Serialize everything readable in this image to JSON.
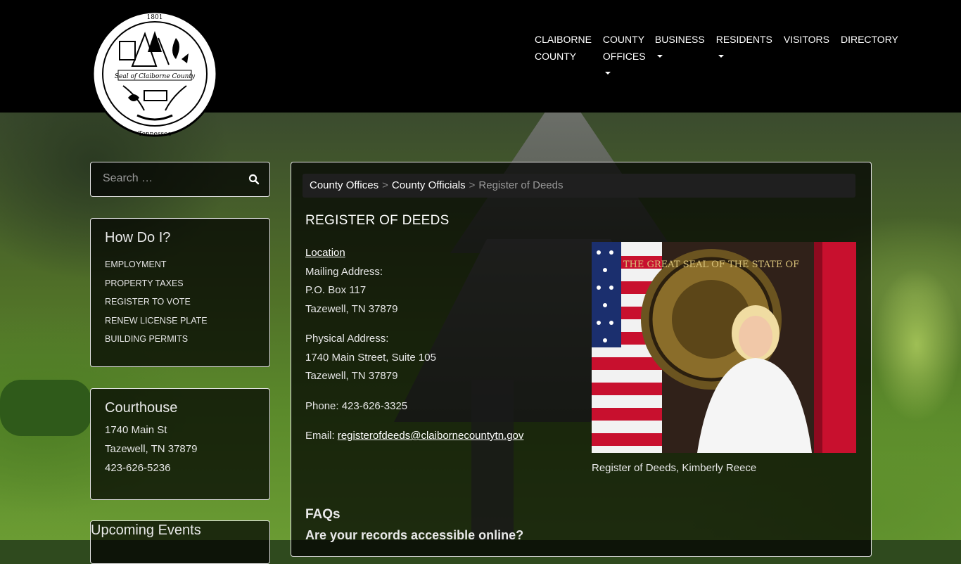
{
  "header": {
    "seal_text_top": "1801",
    "seal_text_middle": "Seal of Claiborne County",
    "seal_text_bottom": "Tennessee",
    "nav": [
      {
        "label_line1": "CLAIBORNE",
        "label_line2": "COUNTY"
      },
      {
        "label_line1": "COUNTY",
        "label_line2": "OFFICES"
      },
      {
        "label_line1": "BUSINESS",
        "label_line2": ""
      },
      {
        "label_line1": "RESIDENTS",
        "label_line2": ""
      },
      {
        "label_line1": "VISITORS",
        "label_line2": ""
      },
      {
        "label_line1": "DIRECTORY",
        "label_line2": ""
      }
    ]
  },
  "sidebar": {
    "search_placeholder": "Search …",
    "howdoi": {
      "title": "How Do I?",
      "items": [
        "EMPLOYMENT",
        "PROPERTY TAXES",
        "REGISTER TO VOTE",
        "RENEW LICENSE PLATE",
        "BUILDING PERMITS"
      ]
    },
    "courthouse": {
      "title": "Courthouse",
      "street": "1740 Main St",
      "city": "Tazewell, TN 37879",
      "phone": "423-626-5236"
    },
    "events_title": "Upcoming Events"
  },
  "breadcrumb": {
    "item1": "County Offices",
    "item2": "County Officials",
    "current": "Register of Deeds",
    "sep": ">"
  },
  "main": {
    "title": "REGISTER OF DEEDS",
    "location_label": "Location",
    "mailing_label": "Mailing Address:",
    "mailing_line1": "P.O. Box 117",
    "mailing_line2": "Tazewell, TN 37879",
    "physical_label": "Physical Address:",
    "physical_line1": "1740 Main Street, Suite 105",
    "physical_line2": "Tazewell, TN 37879",
    "phone": "Phone: 423-626-3325",
    "email_label": "Email: ",
    "email": "registerofdeeds@claibornecountytn.gov",
    "photo_caption": "Register of Deeds, Kimberly Reece",
    "photo_seal_text": "THE GREAT SEAL OF THE STATE OF",
    "faqs_title": "FAQs",
    "faq_question": "Are your records accessible online?"
  },
  "colors": {
    "header_bg": "#000000",
    "panel_bg": "rgba(0,0,0,0.72)",
    "panel_border": "#e6e6e6"
  }
}
